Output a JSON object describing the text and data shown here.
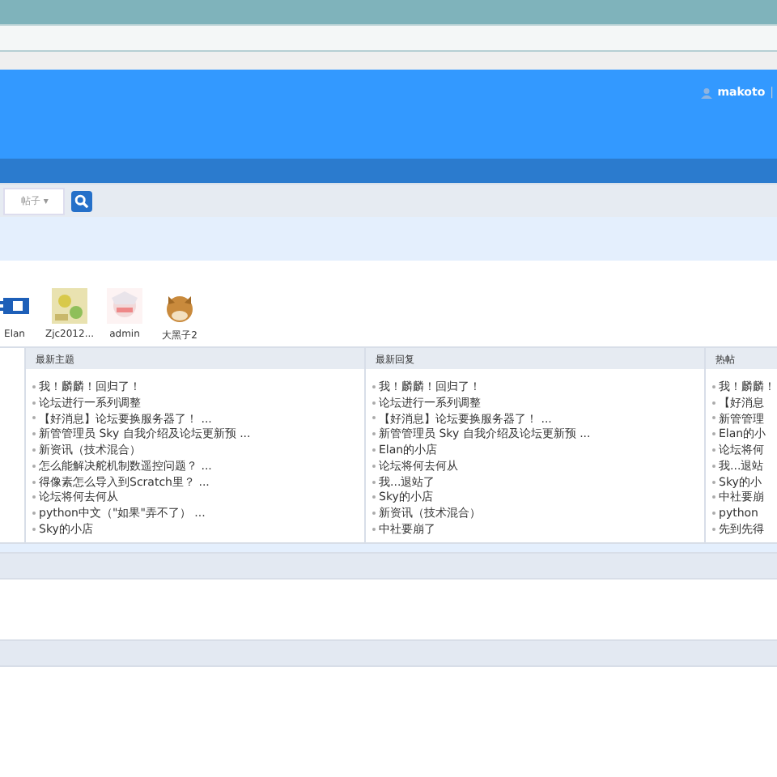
{
  "header": {
    "username": "makoto",
    "separator": "|"
  },
  "search": {
    "scope": "帖子",
    "caret": "▾"
  },
  "members": [
    {
      "name": "Elan"
    },
    {
      "name": "Zjc2012..."
    },
    {
      "name": "admin"
    },
    {
      "name": "大黑子2"
    }
  ],
  "columns": [
    {
      "title": "最新主题",
      "items": [
        "我！麟麟！回归了！",
        "论坛进行一系列调整",
        "【好消息】论坛要换服务器了！ ...",
        "新管管理员 Sky 自我介绍及论坛更新预 ...",
        "新资讯（技术混合）",
        "怎么能解决舵机制数遥控问题？ ...",
        "得像素怎么导入到Scratch里？ ...",
        "论坛将何去何从",
        "python中文（\"如果\"弄不了） ...",
        "Sky的小店"
      ]
    },
    {
      "title": "最新回复",
      "items": [
        "我！麟麟！回归了！",
        "论坛进行一系列调整",
        "【好消息】论坛要换服务器了！ ...",
        "新管管理员 Sky 自我介绍及论坛更新预 ...",
        "Elan的小店",
        "论坛将何去何从",
        "我...退站了",
        "Sky的小店",
        "新资讯（技术混合）",
        "中社要崩了"
      ]
    },
    {
      "title": "热帖",
      "items": [
        "我！麟麟！",
        "【好消息",
        "新管管理",
        "Elan的小",
        "论坛将何",
        "我...退站",
        "Sky的小",
        "中社要崩",
        "python",
        "先到先得"
      ]
    }
  ]
}
